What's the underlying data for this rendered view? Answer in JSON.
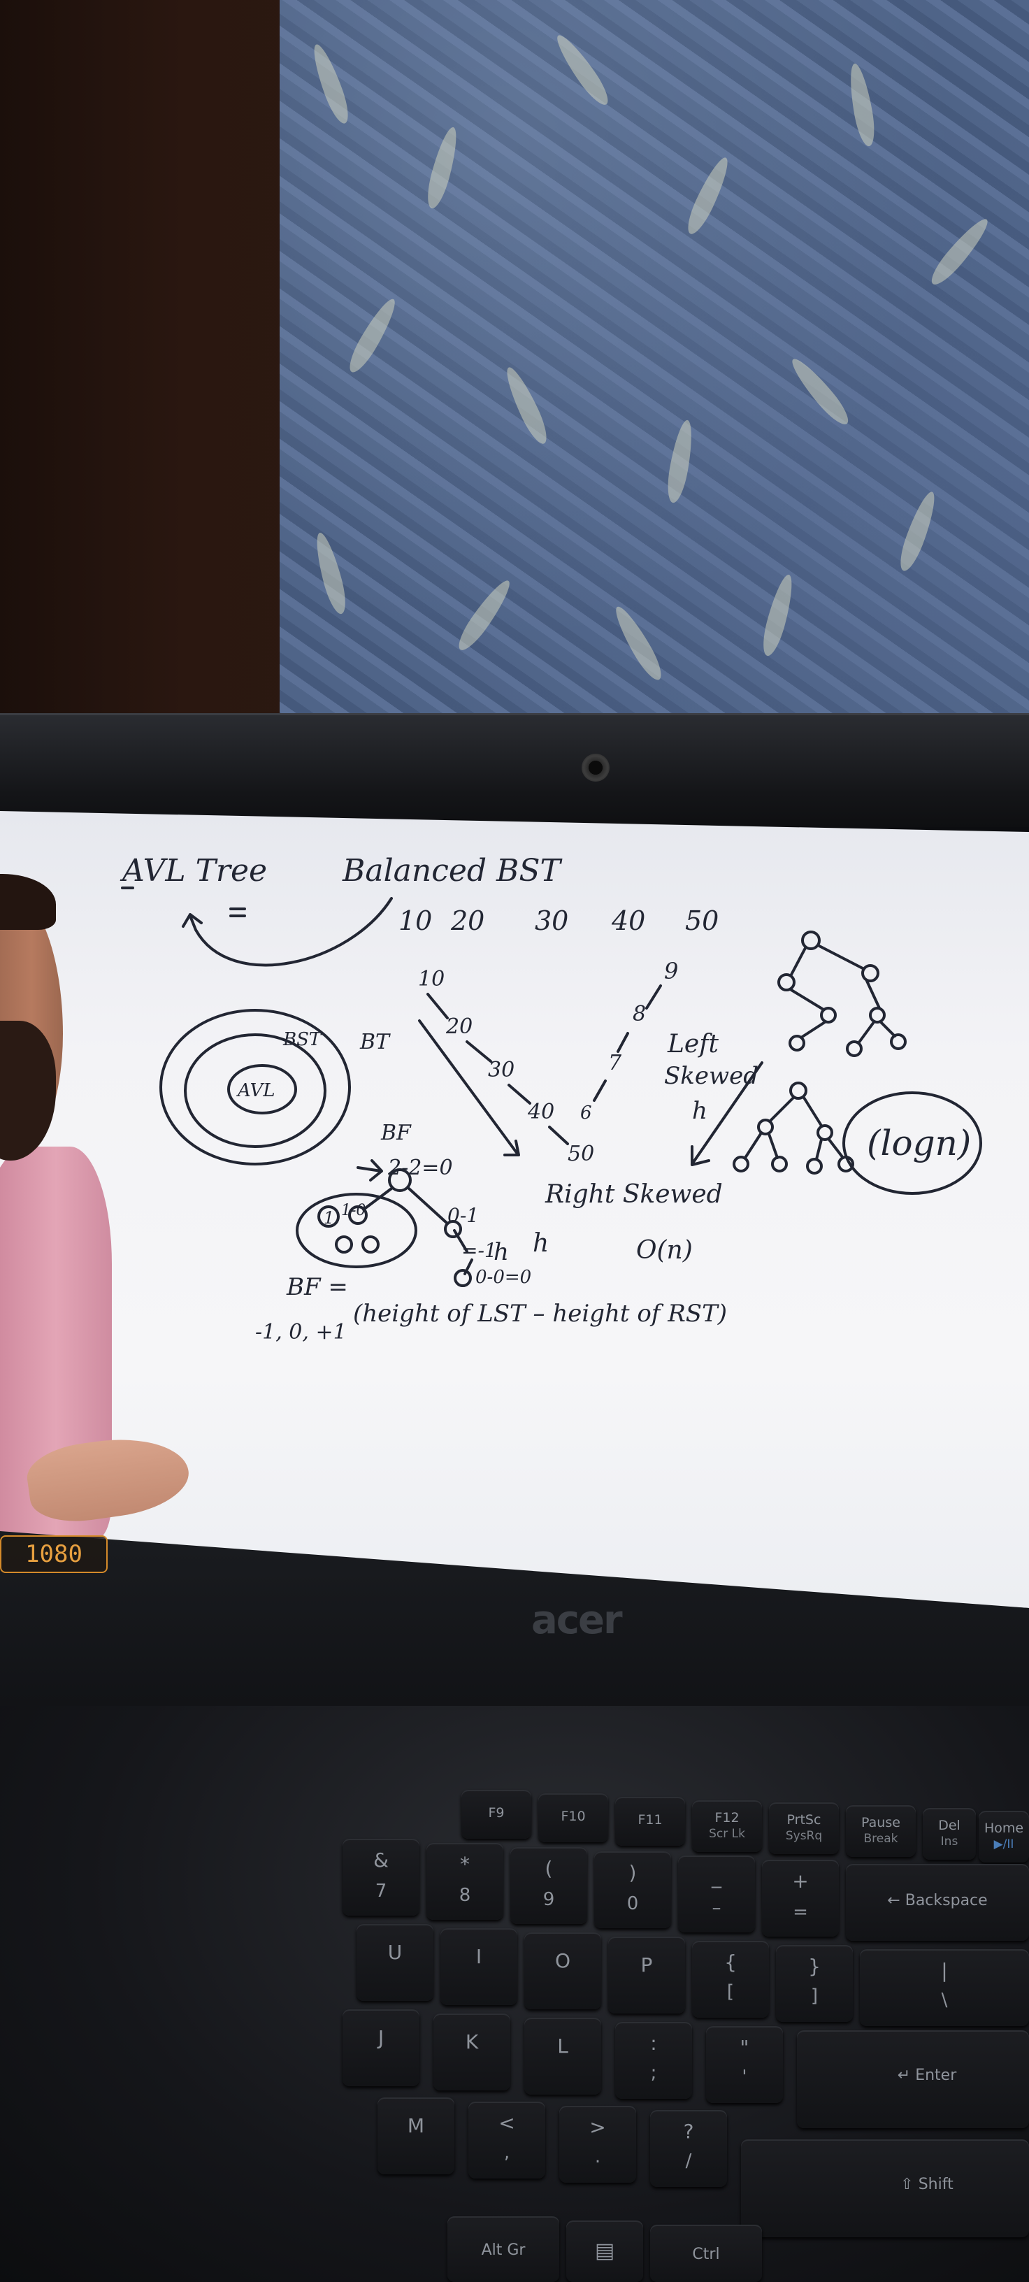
{
  "whiteboard": {
    "title": "AVL Tree",
    "heading": "Balanced BST",
    "sequence": [
      "10",
      "20",
      "30",
      "40",
      "50"
    ],
    "venn": {
      "outer": "BT",
      "middle": "BST",
      "inner": "AVL"
    },
    "right_skewed": {
      "nodes": [
        "10",
        "20",
        "30",
        "40",
        "50"
      ],
      "label": "Right Skewed",
      "height": "h",
      "complexity": "O(n)"
    },
    "left_skewed": {
      "nodes": [
        "9",
        "8",
        "7",
        "6"
      ],
      "label_line1": "Left",
      "label_line2": "Skewed",
      "height": "h"
    },
    "balanced_tree": {
      "complexity": "(logn)"
    },
    "bf_example": {
      "label": "BF",
      "root_calc": "2-2=0",
      "left_node": "1-0",
      "left_child_calc": "0-1",
      "left_child_result": "=-1",
      "leaf_calc": "0-0=0",
      "height": "h",
      "circled_number": "1"
    },
    "bf_formula": {
      "lhs": "BF =",
      "expression": "(height of LST – height of RST)",
      "range": "-1, 0, +1"
    }
  },
  "laptop": {
    "brand": "acer",
    "resolution_badge": "1080"
  },
  "keyboard": {
    "function_row": [
      "F9",
      "F10",
      "F11",
      "F12",
      "PrtSc",
      "Pause",
      "Del",
      "Home"
    ],
    "function_row_sub": [
      "",
      "",
      "",
      "Scr Lk",
      "SysRq",
      "Break",
      "Ins",
      "▶/II"
    ],
    "number_row": [
      "&",
      "*",
      "(",
      ")",
      "_",
      "+"
    ],
    "number_row_lower": [
      "7",
      "8",
      "9",
      "0",
      "–",
      "="
    ],
    "backspace": "Backspace",
    "top_letters": [
      "U",
      "I",
      "O",
      "P",
      "{",
      "}",
      "|"
    ],
    "top_letters_lower": [
      "",
      "",
      "",
      "",
      "[",
      "]",
      "\\"
    ],
    "home_letters": [
      "J",
      "K",
      "L",
      ":",
      "\""
    ],
    "home_letters_lower": [
      "",
      "",
      "",
      ";",
      "'"
    ],
    "enter": "Enter",
    "bottom_letters": [
      "M",
      "<",
      ">",
      "?"
    ],
    "bottom_letters_lower": [
      "",
      ",",
      ".",
      "/"
    ],
    "shift": "Shift",
    "alt_gr": "Alt Gr",
    "ctrl": "Ctrl"
  }
}
